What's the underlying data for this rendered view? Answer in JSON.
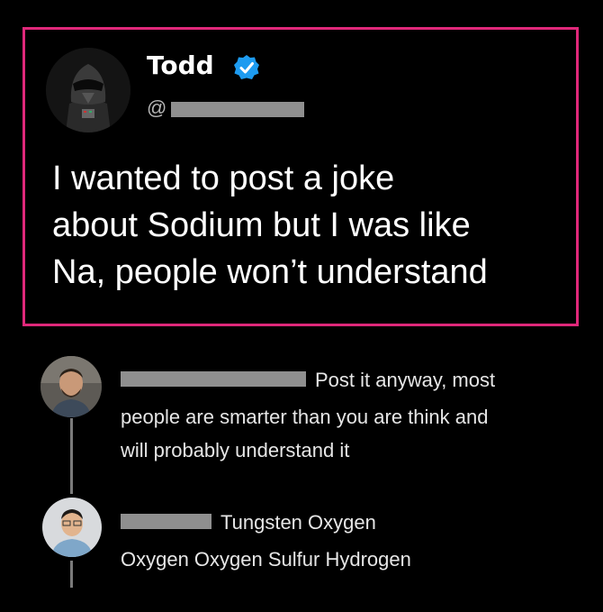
{
  "tweet": {
    "display_name": "Todd",
    "handle_prefix": "@",
    "lines": [
      "I wanted to post a joke",
      "about Sodium but I was like",
      "Na, people won’t understand"
    ]
  },
  "replies": [
    {
      "lines": [
        "Post it anyway, most",
        "people are smarter than you are think and",
        "will probably understand it"
      ]
    },
    {
      "lines": [
        "Tungsten Oxygen",
        "Oxygen Oxygen Sulfur Hydrogen"
      ]
    }
  ],
  "colors": {
    "highlight_border": "#e0287a",
    "verified_badge": "#1d9bf0",
    "background": "#000000",
    "redaction": "#8f8f8f"
  }
}
